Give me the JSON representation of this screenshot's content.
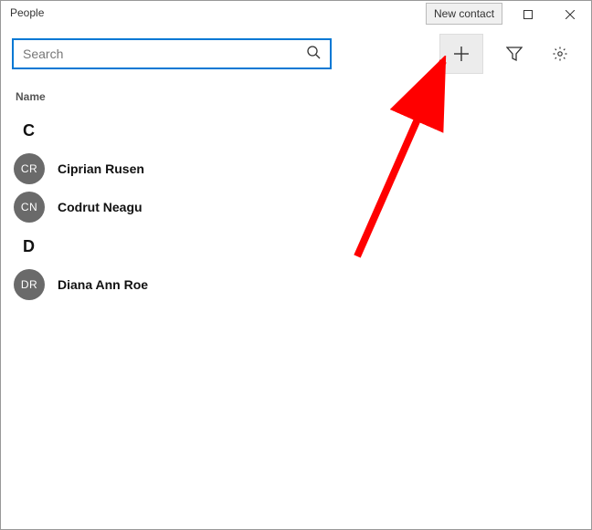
{
  "app": {
    "title": "People"
  },
  "tooltip": {
    "new_contact": "New contact"
  },
  "search": {
    "placeholder": "Search"
  },
  "column_header": {
    "name": "Name"
  },
  "groups": [
    {
      "letter": "C",
      "contacts": [
        {
          "initials": "CR",
          "name": "Ciprian Rusen"
        },
        {
          "initials": "CN",
          "name": "Codrut Neagu"
        }
      ]
    },
    {
      "letter": "D",
      "contacts": [
        {
          "initials": "DR",
          "name": "Diana Ann Roe"
        }
      ]
    }
  ]
}
